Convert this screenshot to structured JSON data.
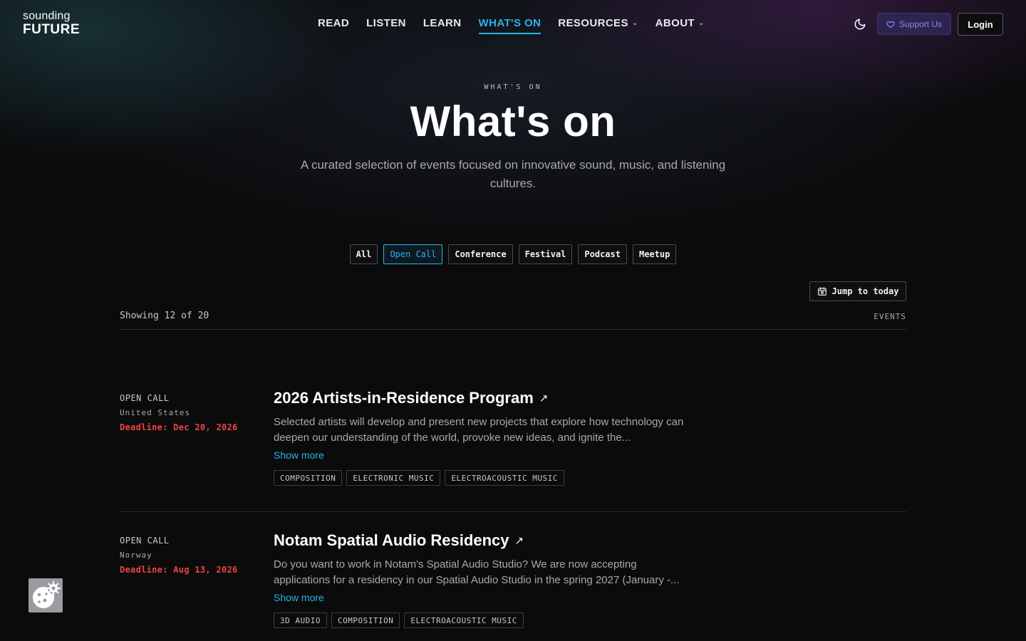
{
  "brand": {
    "line1": "sounding",
    "line2": "FUTURE"
  },
  "nav": {
    "items": [
      {
        "label": "READ",
        "active": false,
        "dropdown": false
      },
      {
        "label": "LISTEN",
        "active": false,
        "dropdown": false
      },
      {
        "label": "LEARN",
        "active": false,
        "dropdown": false
      },
      {
        "label": "WHAT'S ON",
        "active": true,
        "dropdown": false
      },
      {
        "label": "RESOURCES",
        "active": false,
        "dropdown": true
      },
      {
        "label": "ABOUT",
        "active": false,
        "dropdown": true
      }
    ],
    "theme_icon": "moon-icon",
    "support_label": "Support Us",
    "support_icon": "heart-icon",
    "login_label": "Login"
  },
  "hero": {
    "eyebrow": "WHAT'S ON",
    "title": "What's on",
    "subtitle": "A curated selection of events focused on innovative sound, music, and listening cultures."
  },
  "filters": {
    "options": [
      "All",
      "Open Call",
      "Conference",
      "Festival",
      "Podcast",
      "Meetup"
    ],
    "selected": "Open Call"
  },
  "toolbar": {
    "jump_label": "Jump to today",
    "jump_icon": "calendar-icon",
    "showing_text": "Showing 12 of 20",
    "events_label": "EVENTS"
  },
  "events": [
    {
      "type": "OPEN CALL",
      "country": "United States",
      "deadline": "Deadline: Dec 20, 2026",
      "title": "2026 Artists-in-Residence Program",
      "description": "Selected artists will develop and present new projects that explore how technology can deepen our understanding of the world, provoke new ideas, and ignite the...",
      "show_more": "Show more",
      "tags": [
        "COMPOSITION",
        "ELECTRONIC MUSIC",
        "ELECTROACOUSTIC MUSIC"
      ]
    },
    {
      "type": "OPEN CALL",
      "country": "Norway",
      "deadline": "Deadline: Aug 13, 2026",
      "title": "Notam Spatial Audio Residency",
      "description": "Do you want to work in Notam's Spatial Audio Studio? We are now accepting applications for a residency in our Spatial Audio Studio in the spring 2027 (January -...",
      "show_more": "Show more",
      "tags": [
        "3D AUDIO",
        "COMPOSITION",
        "ELECTROACOUSTIC MUSIC"
      ]
    }
  ],
  "cookie": {
    "icon": "cookie-settings-icon"
  },
  "colors": {
    "accent": "#2bb3e6",
    "deadline": "#ef4444",
    "support": "#8f86ec",
    "background": "#0b0b0c"
  }
}
